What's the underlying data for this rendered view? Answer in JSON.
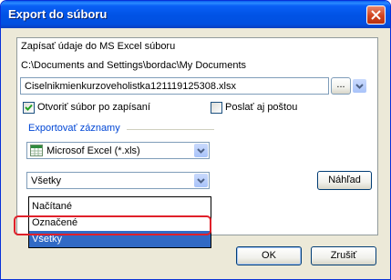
{
  "window": {
    "title": "Export do súboru"
  },
  "main": {
    "write_label": "Zapísať údaje do MS Excel súboru",
    "path": "C:\\Documents and Settings\\bordac\\My Documents",
    "filename": "Ciselnikmienkurzoveholistka121119125308.xlsx",
    "browse_label": "...",
    "open_after_save": {
      "label": "Otvoriť súbor po zapísaní",
      "checked": true
    },
    "send_by_mail": {
      "label": "Poslať aj poštou",
      "checked": false
    },
    "export_records_label": "Exportovať záznamy",
    "format": {
      "value": "Microsof Excel (*.xls)",
      "icon": "excel-icon"
    },
    "records": {
      "value": "Všetky",
      "options": [
        "Načítané",
        "Označené",
        "Všetky"
      ],
      "selected_index": 2
    },
    "preview_label": "Náhľad"
  },
  "buttons": {
    "ok": "OK",
    "cancel": "Zrušiť"
  },
  "colors": {
    "title_bar": "#0153e6",
    "selection": "#316ac5",
    "highlight_ring": "#e0202a"
  }
}
